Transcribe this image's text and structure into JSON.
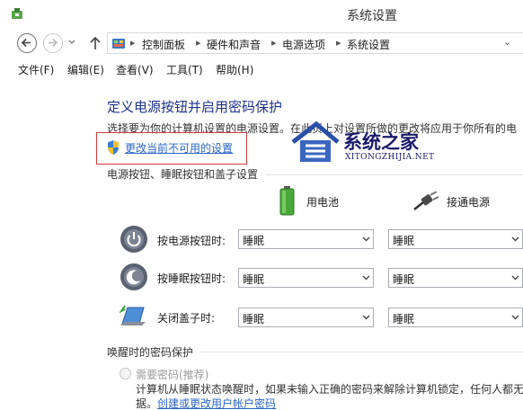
{
  "window": {
    "title": "系统设置"
  },
  "breadcrumb": [
    "控制面板",
    "硬件和声音",
    "电源选项",
    "系统设置"
  ],
  "menu": [
    "文件(F)",
    "编辑(E)",
    "查看(V)",
    "工具(T)",
    "帮助(H)"
  ],
  "page": {
    "heading": "定义电源按钮并启用密码保护",
    "description": "选择要为你的计算机设置的电源设置。在此页上对设置所做的更改将应用于你所有的电",
    "change_link": "更改当前不可用的设置",
    "section_buttons": "电源按钮、睡眠按钮和盖子设置",
    "col_battery": "用电池",
    "col_plugged": "接通电源",
    "rows": [
      {
        "label": "按电源按钮时:",
        "icon": "power-button-icon",
        "battery": "睡眠",
        "plugged": "睡眠"
      },
      {
        "label": "按睡眠按钮时:",
        "icon": "sleep-button-icon",
        "battery": "睡眠",
        "plugged": "睡眠"
      },
      {
        "label": "关闭盖子时:",
        "icon": "laptop-lid-icon",
        "battery": "睡眠",
        "plugged": "睡眠"
      }
    ],
    "wake_section": "唤醒时的密码保护",
    "require_password": "需要密码(推荐)",
    "wake_desc": "计算机从睡眠状态唤醒时，如果未输入正确的密码来解除计算机锁定，任何人都无",
    "wake_desc2_prefix": "据。",
    "account_link": "创建或更改用户帐户密码"
  },
  "watermark": {
    "text": "系统之家",
    "sub": "XITONGZHIJIA.NET"
  },
  "colors": {
    "link": "#2b64c4",
    "heading": "#1e3287",
    "highlight_box": "#d13b3b"
  }
}
